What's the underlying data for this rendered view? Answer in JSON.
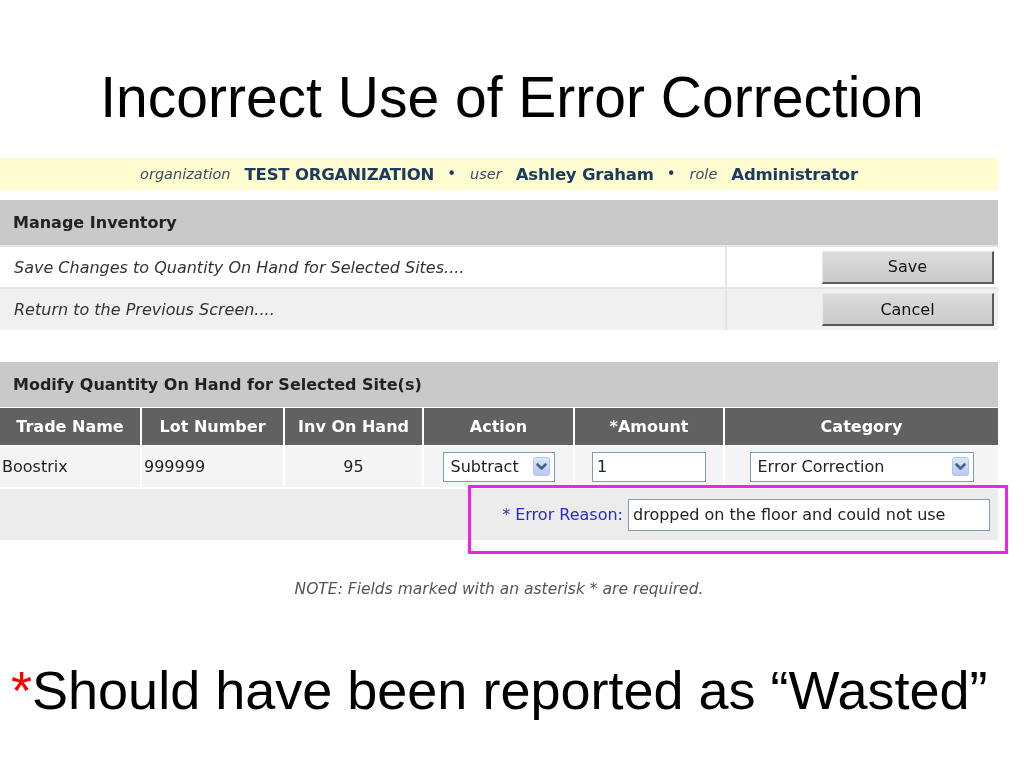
{
  "slide": {
    "title": "Incorrect Use of Error Correction"
  },
  "screenshot": {
    "context_bar": [
      {
        "label": "organization",
        "value": "TEST ORGANIZATION",
        "separator": "•"
      },
      {
        "label": "user",
        "value": "Ashley Graham",
        "separator": "•"
      },
      {
        "label": "role",
        "value": "Administrator"
      }
    ],
    "manage_inventory": {
      "title": "Manage Inventory",
      "actions": [
        {
          "description": "Save Changes to Quantity On Hand for Selected Sites....",
          "button": "Save"
        },
        {
          "description": "Return to the Previous Screen....",
          "button": "Cancel"
        }
      ]
    },
    "modify_quantity": {
      "title": "Modify Quantity On Hand for Selected Site(s)",
      "table": {
        "columns": [
          "Trade Name",
          "Lot Number",
          "Inv On Hand",
          "Action",
          "*Amount",
          "Category"
        ],
        "rows": [
          {
            "cells": [
              {
                "kind": "text",
                "value": "Boostrix"
              },
              {
                "kind": "text",
                "value": "999999"
              },
              {
                "kind": "quantity",
                "value": "95"
              },
              {
                "kind": "select",
                "value": "Subtract"
              },
              {
                "kind": "input",
                "value": "1"
              },
              {
                "kind": "select",
                "value": "Error Correction"
              }
            ]
          }
        ]
      },
      "error_reason": {
        "label": "* Error Reason:",
        "value": "dropped on the floor and could not use",
        "highlighted": true
      }
    },
    "note": "NOTE: Fields marked with an asterisk * are required."
  },
  "footnote": {
    "marker": "*",
    "text": "Should have been reported as “Wasted”"
  }
}
